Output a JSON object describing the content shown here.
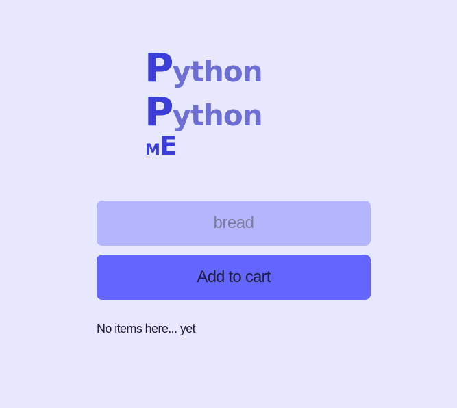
{
  "logo": {
    "line1_initial": "P",
    "line1_rest": "ython",
    "line2_initial": "P",
    "line2_rest": "ython",
    "line3_m": "M",
    "line3_e": "E"
  },
  "colors": {
    "background": "#e7e7fd",
    "logo_primary": "#3b3fd8",
    "logo_secondary": "#6e6fd4",
    "input_background": "#b5b5fe",
    "button_background": "#6464fe",
    "text_dark": "#1e1e3c"
  },
  "form": {
    "input_placeholder": "bread",
    "input_value": "",
    "add_button_label": "Add to cart"
  },
  "cart": {
    "empty_message": "No items here... yet"
  }
}
